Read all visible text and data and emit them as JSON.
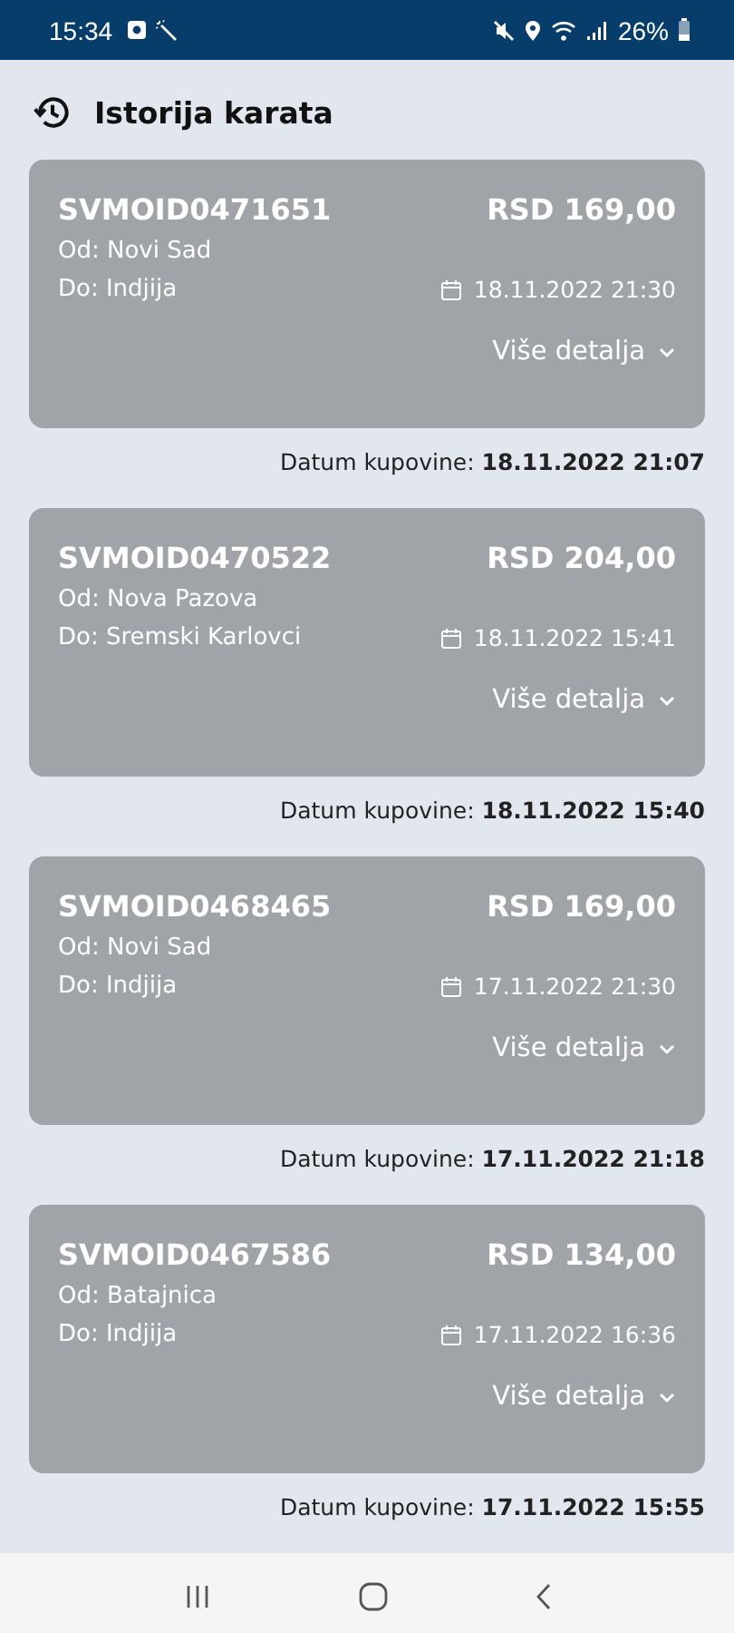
{
  "status_bar": {
    "time": "15:34",
    "battery": "26%"
  },
  "header": {
    "title": "Istorija karata"
  },
  "tickets": [
    {
      "id": "SVMOID0471651",
      "price": "RSD 169,00",
      "from": "Od: Novi Sad",
      "to": "Do: Indjija",
      "departure": "18.11.2022 21:30",
      "details": "Više detalja",
      "purchase": "Datum kupovine: **18.11.2022 21:07**"
    },
    {
      "id": "SVMOID0470522",
      "price": "RSD 204,00",
      "from": "Od: Nova Pazova",
      "to": "Do: Sremski Karlovci",
      "departure": "18.11.2022 15:41",
      "details": "Više detalja",
      "purchase": "Datum kupovine: **18.11.2022 15:40**"
    },
    {
      "id": "SVMOID0468465",
      "price": "RSD 169,00",
      "from": "Od: Novi Sad",
      "to": "Do: Indjija",
      "departure": "17.11.2022 21:30",
      "details": "Više detalja",
      "purchase": "Datum kupovine: **17.11.2022 21:18**"
    },
    {
      "id": "SVMOID0467586",
      "price": "RSD 134,00",
      "from": "Od: Batajnica",
      "to": "Do: Indjija",
      "departure": "17.11.2022 16:36",
      "details": "Više detalja",
      "purchase": "Datum kupovine: **17.11.2022 15:55**"
    }
  ]
}
